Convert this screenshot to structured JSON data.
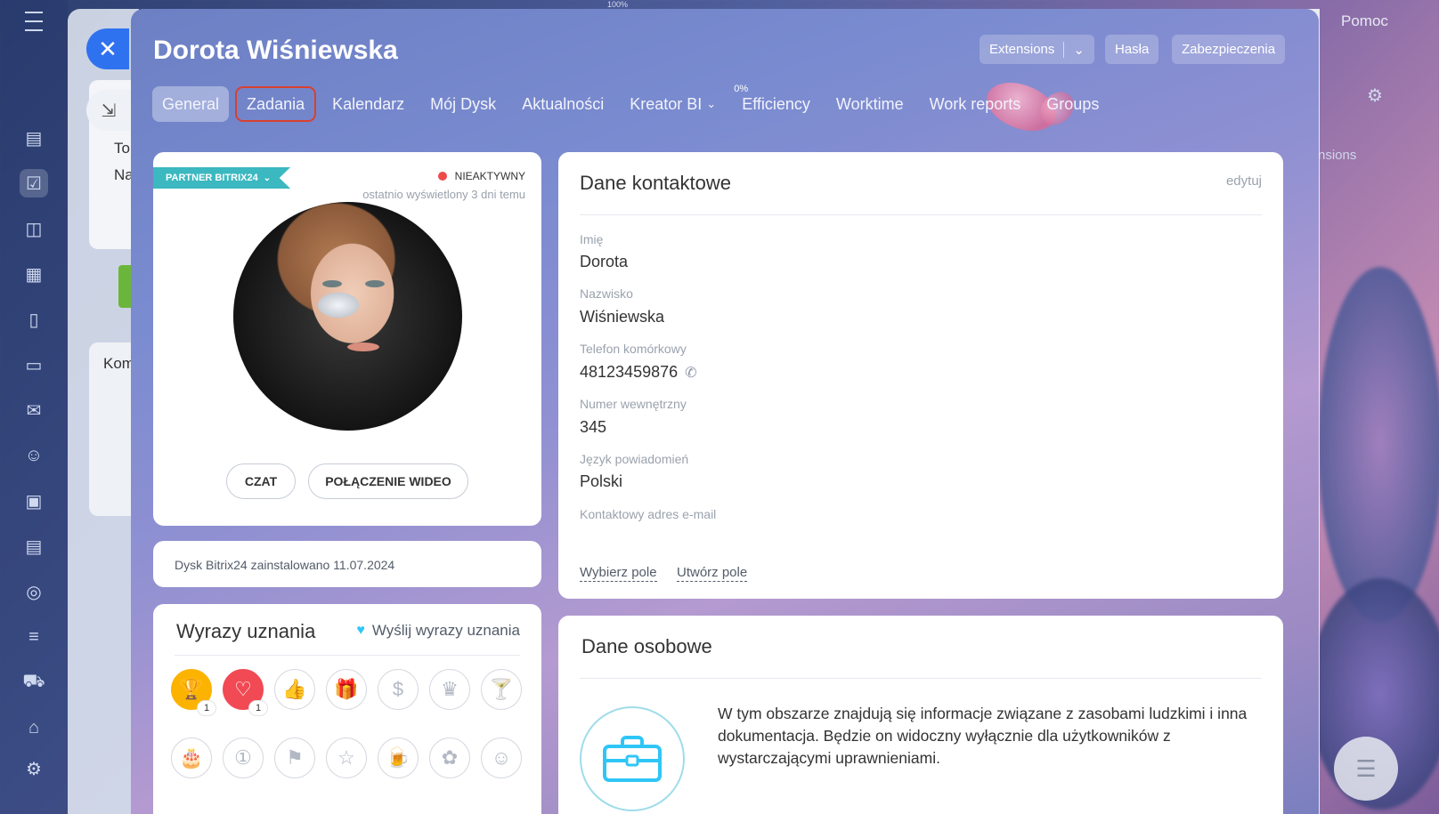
{
  "topbar": {
    "zoom": "100%",
    "help": "Pomoc"
  },
  "header": {
    "title": "Dorota Wiśniewska",
    "buttons": {
      "extensions": "Extensions",
      "passwords": "Hasła",
      "security": "Zabezpieczenia"
    }
  },
  "tabs": [
    {
      "label": "General",
      "active": true
    },
    {
      "label": "Zadania",
      "highlighted": true
    },
    {
      "label": "Kalendarz"
    },
    {
      "label": "Mój Dysk"
    },
    {
      "label": "Aktualności"
    },
    {
      "label": "Kreator BI",
      "dropdown": true
    },
    {
      "label": "Efficiency",
      "superscript": "0%"
    },
    {
      "label": "Worktime"
    },
    {
      "label": "Work reports"
    },
    {
      "label": "Groups"
    }
  ],
  "profile": {
    "ribbon": "PARTNER BITRIX24",
    "status": "NIEAKTYWNY",
    "status_color": "#ef4a4a",
    "last_seen": "ostatnio wyświetlony 3 dni temu",
    "chat_button": "CZAT",
    "video_button": "POŁĄCZENIE WIDEO"
  },
  "disk": {
    "text": "Dysk Bitrix24 zainstalowano 11.07.2024"
  },
  "appreciation": {
    "title": "Wyrazy uznania",
    "send_link": "Wyślij wyrazy uznania",
    "badges": [
      {
        "icon": "trophy-icon",
        "count": "1"
      },
      {
        "icon": "heart-icon",
        "count": "1"
      },
      {
        "icon": "thumbs-up-icon"
      },
      {
        "icon": "gift-icon"
      },
      {
        "icon": "money-bag-icon"
      },
      {
        "icon": "crown-icon"
      },
      {
        "icon": "cocktail-icon"
      },
      {
        "icon": "cake-icon"
      },
      {
        "icon": "number-one-icon"
      },
      {
        "icon": "flag-icon"
      },
      {
        "icon": "star-icon"
      },
      {
        "icon": "beer-icon"
      },
      {
        "icon": "flower-icon"
      },
      {
        "icon": "smile-icon"
      }
    ]
  },
  "contact": {
    "title": "Dane kontaktowe",
    "edit": "edytuj",
    "fields": [
      {
        "label": "Imię",
        "value": "Dorota"
      },
      {
        "label": "Nazwisko",
        "value": "Wiśniewska"
      },
      {
        "label": "Telefon komórkowy",
        "value": "48123459876"
      },
      {
        "label": "Numer wewnętrzny",
        "value": "345"
      },
      {
        "label": "Język powiadomień",
        "value": "Polski"
      },
      {
        "label": "Kontaktowy adres e-mail",
        "value": ""
      }
    ],
    "choose_field": "Wybierz pole",
    "create_field": "Utwórz pole"
  },
  "personal": {
    "title": "Dane osobowe",
    "text": "W tym obszarze znajdują się informacje związane z zasobami ludzkimi i inna dokumentacja. Będzie on widoczny wyłącznie dla użytkowników z wystarczającymi uprawnieniami."
  },
  "background_page": {
    "to": "To",
    "na": "Na",
    "kom": "Kom",
    "extensions": "nsions"
  }
}
